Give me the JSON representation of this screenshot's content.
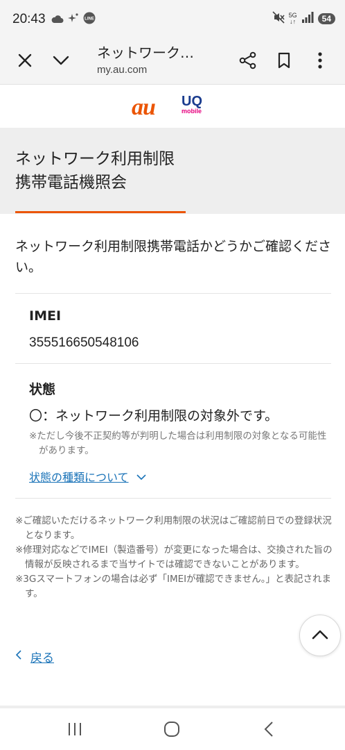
{
  "status_bar": {
    "time": "20:43",
    "network": "5G",
    "battery": "54",
    "icons": [
      "cloud-icon",
      "sparkle-icon",
      "line-app-icon",
      "mute-icon",
      "signal-icon"
    ]
  },
  "browser": {
    "page_title": "ネットワーク…",
    "url": "my.au.com",
    "icons": [
      "close-icon",
      "chevron-down-icon",
      "share-icon",
      "bookmark-icon",
      "more-icon"
    ]
  },
  "logos": {
    "au": "au",
    "uq": "UQ",
    "uq_sub": "mobile"
  },
  "header": {
    "title_line1": "ネットワーク利用制限",
    "title_line2": "携帯電話機照会",
    "accent_color": "#eb5505"
  },
  "intro_text": "ネットワーク利用制限携帯電話かどうかご確認ください。",
  "imei": {
    "label": "IMEI",
    "value": "355516650548106"
  },
  "status": {
    "label": "状態",
    "result": "〇：ネットワーク利用制限の対象外です。",
    "note": "※ただし今後不正契約等が判明した場合は利用制限の対象となる可能性があります。",
    "link": "状態の種類について"
  },
  "notes": [
    "※ご確認いただけるネットワーク利用制限の状況はご確認前日での登録状況となります。",
    "※修理対応などでIMEI（製造番号）が変更になった場合は、交換された旨の情報が反映されるまで当サイトでは確認できないことがあります。",
    "※3Gスマートフォンの場合は必ず「IMEIが確認できません。」と表記されます。"
  ],
  "back_label": "戻る",
  "link_color": "#1a73b8"
}
